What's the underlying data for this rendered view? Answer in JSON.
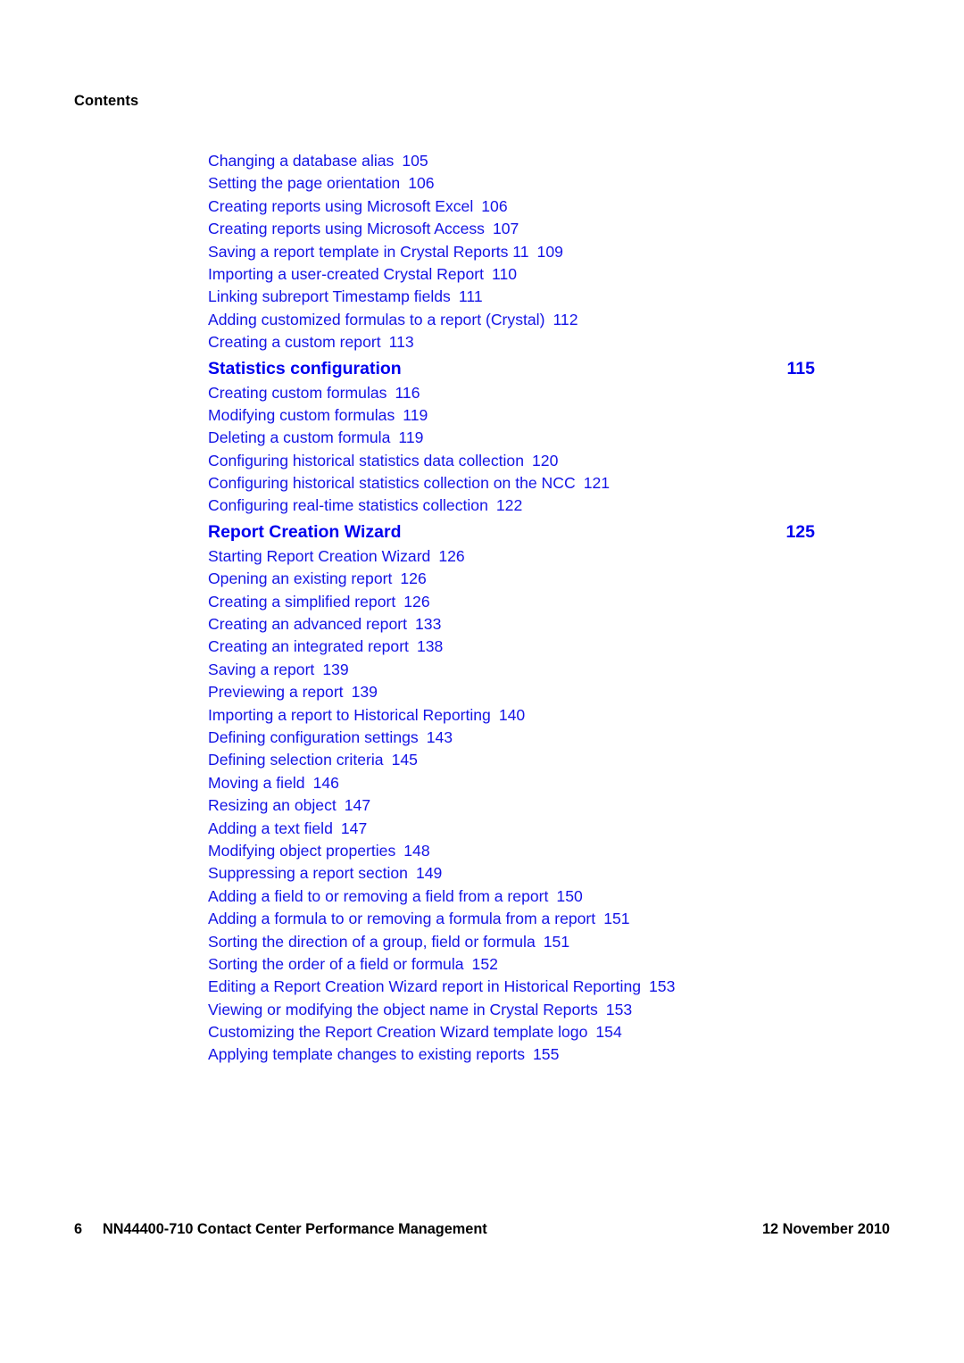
{
  "header": {
    "label": "Contents"
  },
  "colors": {
    "entry_blue": "#1414e6",
    "heading_blue": "#0000ee",
    "footer_black": "#000000",
    "page_background": "#ffffff"
  },
  "toc": {
    "blocks": [
      {
        "type": "entries",
        "items": [
          {
            "title": "Changing a database alias",
            "page": "105"
          },
          {
            "title": "Setting the page orientation",
            "page": "106"
          },
          {
            "title": "Creating reports using Microsoft Excel",
            "page": "106"
          },
          {
            "title": "Creating reports using Microsoft Access",
            "page": "107"
          },
          {
            "title": "Saving a report template in Crystal Reports 11",
            "page": "109"
          },
          {
            "title": "Importing a user-created Crystal Report",
            "page": "110"
          },
          {
            "title": "Linking subreport Timestamp fields",
            "page": "111"
          },
          {
            "title": "Adding customized formulas to a report (Crystal)",
            "page": "112"
          },
          {
            "title": "Creating a custom report",
            "page": "113"
          }
        ]
      },
      {
        "type": "section",
        "title": "Statistics configuration",
        "page": "115"
      },
      {
        "type": "entries",
        "items": [
          {
            "title": "Creating custom formulas",
            "page": "116"
          },
          {
            "title": "Modifying custom formulas",
            "page": "119"
          },
          {
            "title": "Deleting a custom formula",
            "page": "119"
          },
          {
            "title": "Configuring historical statistics data collection",
            "page": "120"
          },
          {
            "title": "Configuring historical statistics collection on the NCC",
            "page": "121"
          },
          {
            "title": "Configuring real-time statistics collection",
            "page": "122"
          }
        ]
      },
      {
        "type": "section",
        "title": "Report Creation Wizard",
        "page": "125"
      },
      {
        "type": "entries",
        "items": [
          {
            "title": "Starting Report Creation Wizard",
            "page": "126"
          },
          {
            "title": "Opening an existing report",
            "page": "126"
          },
          {
            "title": "Creating a simplified report",
            "page": "126"
          },
          {
            "title": "Creating an advanced report",
            "page": "133"
          },
          {
            "title": "Creating an integrated report",
            "page": "138"
          },
          {
            "title": "Saving a report",
            "page": "139"
          },
          {
            "title": "Previewing a report",
            "page": "139"
          },
          {
            "title": "Importing a report to Historical Reporting",
            "page": "140"
          },
          {
            "title": "Defining configuration settings",
            "page": "143"
          },
          {
            "title": "Defining selection criteria",
            "page": "145"
          },
          {
            "title": "Moving a field",
            "page": "146"
          },
          {
            "title": "Resizing an object",
            "page": "147"
          },
          {
            "title": "Adding a text field",
            "page": "147"
          },
          {
            "title": "Modifying object properties",
            "page": "148"
          },
          {
            "title": "Suppressing a report section",
            "page": "149"
          },
          {
            "title": "Adding a field to or removing a field from a report",
            "page": "150"
          },
          {
            "title": "Adding a formula to or removing a formula from a report",
            "page": "151"
          },
          {
            "title": "Sorting the direction of a group, field or formula",
            "page": "151"
          },
          {
            "title": "Sorting the order of a field or formula",
            "page": "152"
          },
          {
            "title": "Editing a Report Creation Wizard report in Historical Reporting",
            "page": "153"
          },
          {
            "title": "Viewing or modifying the object name in Crystal Reports",
            "page": "153"
          },
          {
            "title": "Customizing the Report Creation Wizard template logo",
            "page": "154"
          },
          {
            "title": "Applying template changes to existing reports",
            "page": "155"
          }
        ]
      }
    ]
  },
  "footer": {
    "page_number": "6",
    "document_title": "NN44400-710 Contact Center Performance Management",
    "date": "12 November 2010"
  }
}
